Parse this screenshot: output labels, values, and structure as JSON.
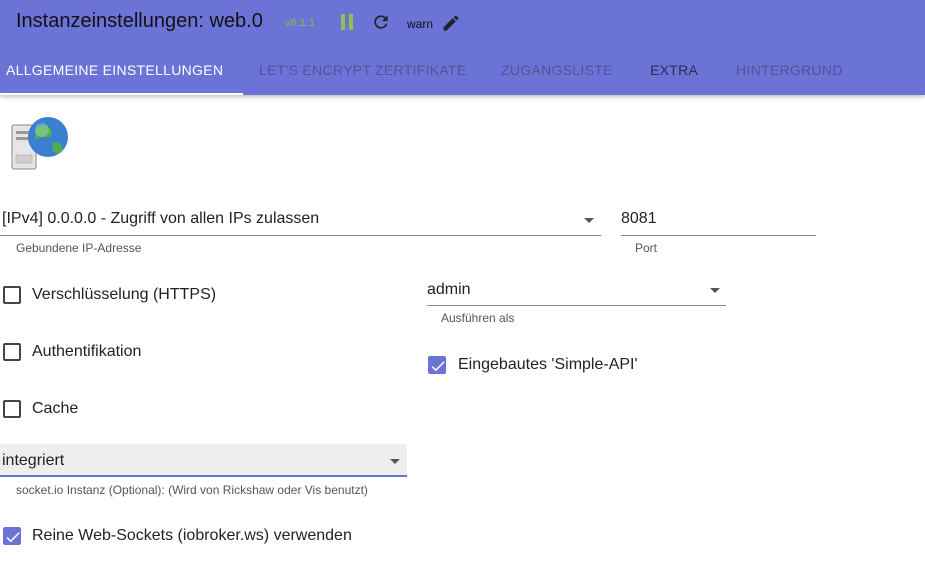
{
  "header": {
    "title": "Instanzeinstellungen: web.0",
    "version": "v6.1.1",
    "loglevel": "warn",
    "icons": [
      "pause-icon",
      "reload-icon",
      "edit-icon"
    ]
  },
  "tabs": [
    {
      "label": "ALLGEMEINE EINSTELLUNGEN",
      "active": true
    },
    {
      "label": "LET'S ENCRYPT ZERTIFIKATE",
      "active": false
    },
    {
      "label": "ZUGANGSLISTE",
      "active": false
    },
    {
      "label": "EXTRA",
      "active": false
    },
    {
      "label": "HINTERGRUND",
      "active": false
    }
  ],
  "form": {
    "bind_ip": {
      "value": "[IPv4] 0.0.0.0 - Zugriff von allen IPs zulassen",
      "helper": "Gebundene IP-Adresse"
    },
    "port": {
      "value": "8081",
      "helper": "Port"
    },
    "https": {
      "label": "Verschlüsselung (HTTPS)",
      "checked": false
    },
    "run_as": {
      "value": "admin",
      "helper": "Ausführen als"
    },
    "auth": {
      "label": "Authentifikation",
      "checked": false
    },
    "simple_api": {
      "label": "Eingebautes 'Simple-API'",
      "checked": true
    },
    "cache": {
      "label": "Cache",
      "checked": false
    },
    "socketio": {
      "value": "integriert",
      "helper": "socket.io Instanz (Optional): (Wird von Rickshaw oder Vis benutzt)"
    },
    "pure_ws": {
      "label": "Reine Web-Sockets (iobroker.ws) verwenden",
      "checked": true
    }
  },
  "colors": {
    "accent": "#6b74d6",
    "running": "#8bc34a"
  }
}
